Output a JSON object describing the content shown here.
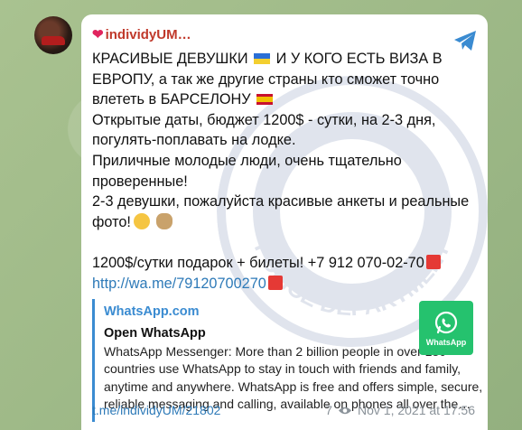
{
  "message": {
    "sender_name": "individyUM…",
    "lines": [
      "КРАСИВЫЕ ДЕВУШКИ",
      "И У КОГО ЕСТЬ ВИЗА В",
      "ЕВРОПУ, а так же другие страны кто сможет точно",
      "влететь в БАРСЕЛОНУ",
      "Открытые даты, бюджет 1200$ - сутки, на 2-3 дня,",
      "погулять-поплавать на лодке.",
      "Приличные молодые люди, очень тщательно",
      "проверенные!",
      "2-3 девушки, пожалуйста красивые анкеты и реальные",
      "фото!",
      "1200$/сутки подарок + билеты! +7 912 070-02-70",
      "http://wa.me/79120700270"
    ]
  },
  "link_preview": {
    "site_name": "WhatsApp.com",
    "title": "Open WhatsApp",
    "description": "WhatsApp Messenger: More than 2 billion people in over 180 countries use WhatsApp to stay in touch with friends and family, anytime and anywhere. WhatsApp is free and offers simple, secure, reliable messaging and calling, available on phones all over the…",
    "thumb_label": "WhatsApp"
  },
  "footer": {
    "post_link": "t.me/individyUM/21802",
    "views": "7",
    "date": "Nov 1, 2021 at 17:56"
  },
  "watermark_text": "POLICE DEPARTMENT",
  "colors": {
    "link": "#2e7ab8",
    "preview_accent": "#3a8bd1",
    "whatsapp_green": "#25c26e",
    "sender_red": "#c0392b"
  }
}
